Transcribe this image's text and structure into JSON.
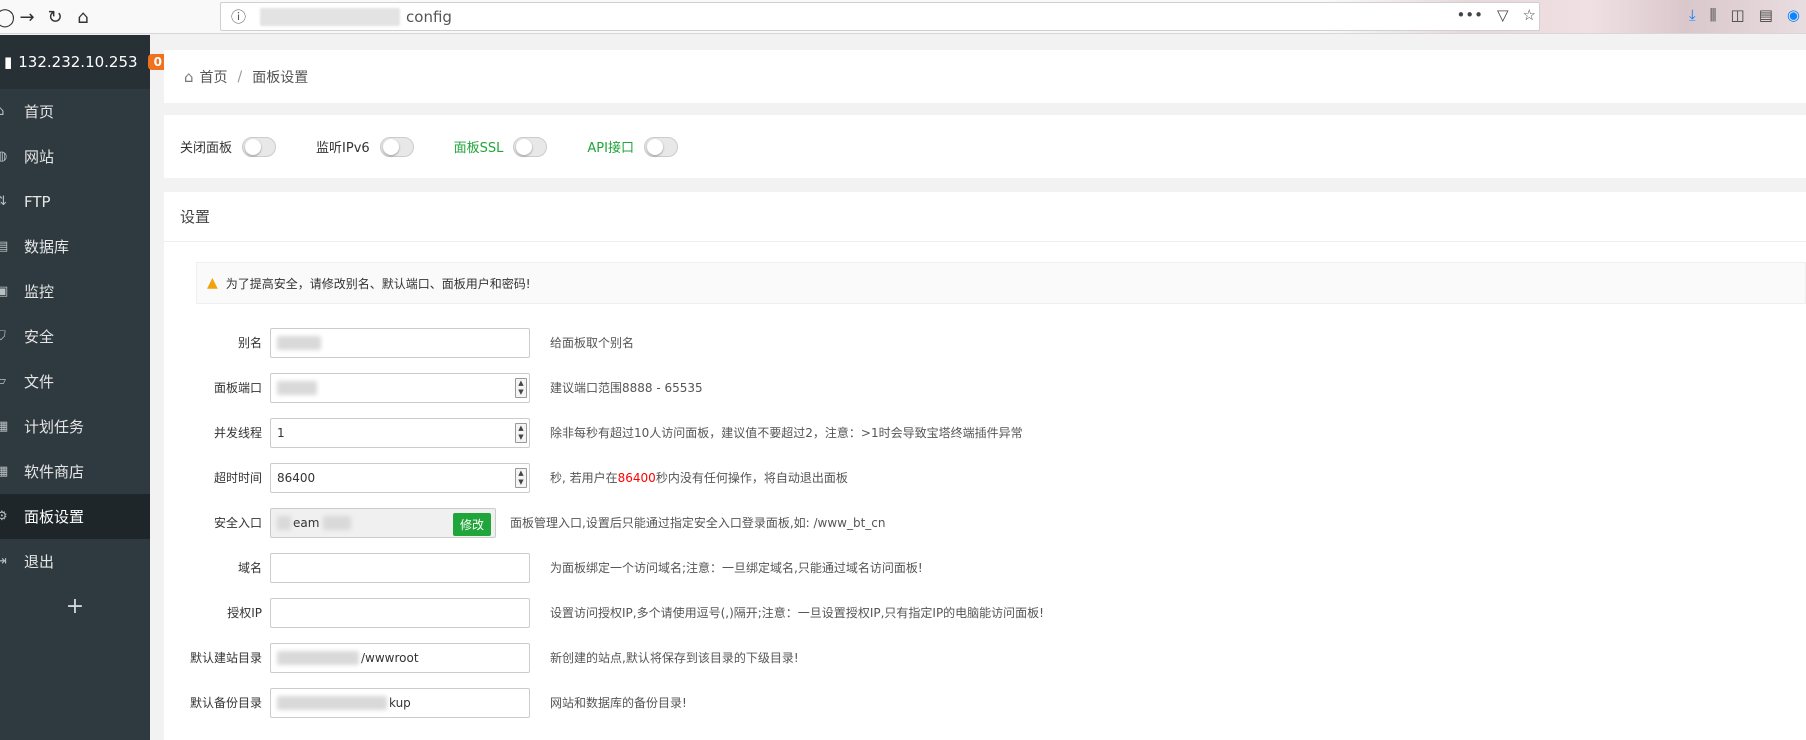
{
  "browser": {
    "url_suffix": "config",
    "info_icon": "info-icon"
  },
  "sidebar": {
    "ip": "132.232.10.253",
    "badge": "0",
    "items": [
      {
        "label": "首页",
        "icon": "home-icon"
      },
      {
        "label": "网站",
        "icon": "globe-icon"
      },
      {
        "label": "FTP",
        "icon": "ftp-icon"
      },
      {
        "label": "数据库",
        "icon": "database-icon"
      },
      {
        "label": "监控",
        "icon": "monitor-icon"
      },
      {
        "label": "安全",
        "icon": "shield-icon"
      },
      {
        "label": "文件",
        "icon": "folder-icon"
      },
      {
        "label": "计划任务",
        "icon": "calendar-icon"
      },
      {
        "label": "软件商店",
        "icon": "apps-icon"
      },
      {
        "label": "面板设置",
        "icon": "gear-icon"
      },
      {
        "label": "退出",
        "icon": "logout-icon"
      }
    ],
    "active_index": 9,
    "add": "+"
  },
  "breadcrumb": {
    "home": "首页",
    "separator": "/",
    "current": "面板设置"
  },
  "switches": [
    {
      "label": "关闭面板",
      "green": false
    },
    {
      "label": "监听IPv6",
      "green": false
    },
    {
      "label": "面板SSL",
      "green": true
    },
    {
      "label": "API接口",
      "green": true
    }
  ],
  "settings": {
    "title": "设置",
    "notice": "为了提高安全，请修改别名、默认端口、面板用户和密码!",
    "rows": {
      "alias": {
        "label": "别名",
        "hint": "给面板取个别名"
      },
      "port": {
        "label": "面板端口",
        "hint": "建议端口范围8888 - 65535"
      },
      "threads": {
        "label": "并发线程",
        "value": "1",
        "hint": "除非每秒有超过10人访问面板，建议值不要超过2，注意：>1时会导致宝塔终端插件异常"
      },
      "timeout": {
        "label": "超时时间",
        "value": "86400",
        "hint_pre": "秒, 若用户在",
        "hint_red": "86400",
        "hint_post": "秒内没有任何操作，将自动退出面板"
      },
      "entry": {
        "label": "安全入口",
        "value_suffix": "eam",
        "button": "修改",
        "hint": "面板管理入口,设置后只能通过指定安全入口登录面板,如: /www_bt_cn"
      },
      "domain": {
        "label": "域名",
        "hint": "为面板绑定一个访问域名;注意：一旦绑定域名,只能通过域名访问面板!"
      },
      "auth_ip": {
        "label": "授权IP",
        "hint": "设置访问授权IP,多个请使用逗号(,)隔开;注意：一旦设置授权IP,只有指定IP的电脑能访问面板!"
      },
      "site_dir": {
        "label": "默认建站目录",
        "value_suffix": "/wwwroot",
        "hint": "新创建的站点,默认将保存到该目录的下级目录!"
      },
      "backup_dir": {
        "label": "默认备份目录",
        "value_suffix": "kup",
        "hint": "网站和数据库的备份目录!"
      }
    }
  }
}
